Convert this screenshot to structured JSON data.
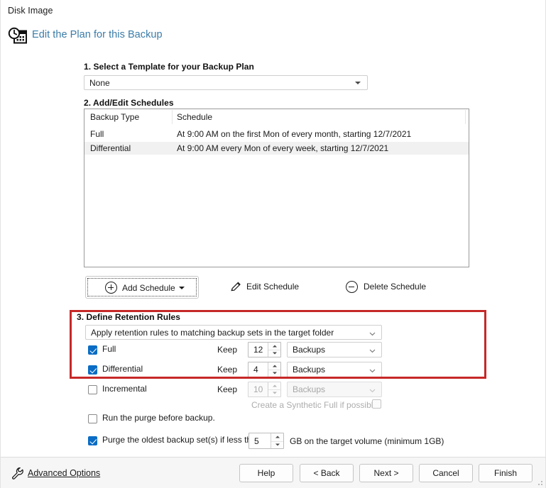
{
  "titlebar": {
    "title": "Disk Image"
  },
  "header": {
    "icon": "schedule-calendar-clock-icon",
    "title": "Edit the Plan for this Backup"
  },
  "steps": {
    "step1_label": "1. Select a Template for your Backup Plan",
    "step2_label": "2. Add/Edit Schedules",
    "step3_label": "3. Define Retention Rules"
  },
  "template": {
    "selected": "None",
    "icon": "triangle-down-icon"
  },
  "schedule_table": {
    "columns": [
      "Backup Type",
      "Schedule"
    ],
    "rows": [
      {
        "type": "Full",
        "schedule": "At 9:00 AM on the first Mon of every month, starting 12/7/2021",
        "selected": false
      },
      {
        "type": "Differential",
        "schedule": "At 9:00 AM every Mon of every week, starting 12/7/2021",
        "selected": true
      }
    ]
  },
  "schedule_actions": {
    "add": "Add Schedule",
    "add_icon": "plus-circle-icon",
    "add_split_icon": "triangle-down-icon",
    "edit": "Edit Schedule",
    "edit_icon": "pencil-icon",
    "delete": "Delete Schedule",
    "delete_icon": "minus-circle-icon"
  },
  "retention": {
    "scope_dropdown": "Apply retention rules to matching backup sets in the target folder",
    "scope_icon": "chevron-down-icon",
    "keep_label": "Keep",
    "unit_icon": "chevron-down-icon",
    "rows": [
      {
        "name": "Full",
        "checked": true,
        "enabled": true,
        "keep": "12",
        "unit": "Backups"
      },
      {
        "name": "Differential",
        "checked": true,
        "enabled": true,
        "keep": "4",
        "unit": "Backups"
      },
      {
        "name": "Incremental",
        "checked": false,
        "enabled": false,
        "keep": "10",
        "unit": "Backups"
      }
    ],
    "synthetic_full": {
      "label": "Create a Synthetic Full if possible",
      "checked": false,
      "enabled": false
    },
    "run_purge_before": {
      "label": "Run the purge before backup.",
      "checked": false
    },
    "purge_oldest": {
      "label": "Purge the oldest backup set(s) if less than",
      "checked": true,
      "value": "5",
      "suffix": "GB on the target volume (minimum 1GB)"
    }
  },
  "annotation": {
    "color": "#c62828"
  },
  "footer": {
    "advanced_options": "Advanced Options",
    "advanced_icon": "wrench-icon",
    "buttons": [
      {
        "label": "Help"
      },
      {
        "label": "< Back"
      },
      {
        "label": "Next >"
      },
      {
        "label": "Cancel"
      },
      {
        "label": "Finish"
      }
    ]
  }
}
